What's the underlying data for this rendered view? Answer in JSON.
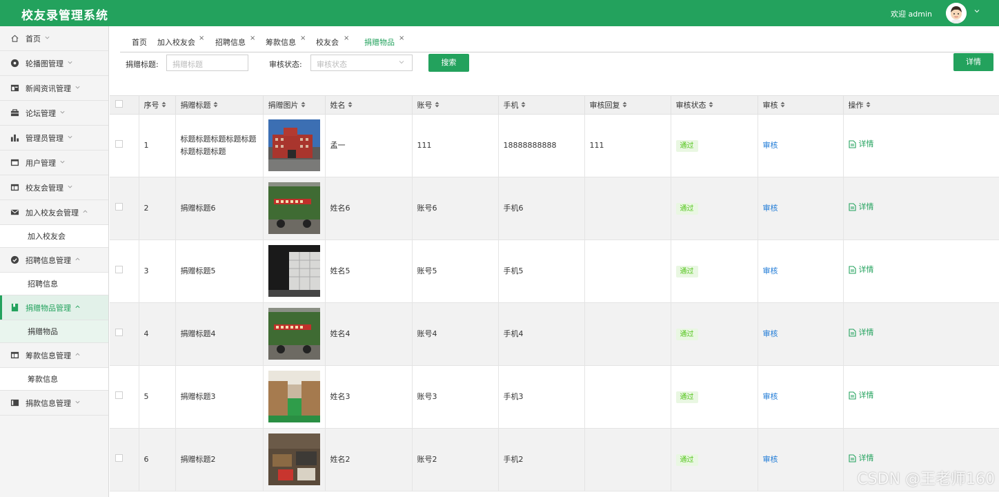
{
  "header": {
    "app_title": "校友录管理系统",
    "welcome": "欢迎 admin"
  },
  "sidebar": {
    "items": [
      {
        "label": "首页",
        "icon": "home-icon",
        "expanded": false,
        "active": false
      },
      {
        "label": "轮播图管理",
        "icon": "carousel-icon",
        "expanded": false,
        "active": false
      },
      {
        "label": "新闻资讯管理",
        "icon": "news-icon",
        "expanded": false,
        "active": false
      },
      {
        "label": "论坛管理",
        "icon": "forum-icon",
        "expanded": false,
        "active": false
      },
      {
        "label": "管理员管理",
        "icon": "admin-chart-icon",
        "expanded": false,
        "active": false
      },
      {
        "label": "用户管理",
        "icon": "user-card-icon",
        "expanded": false,
        "active": false
      },
      {
        "label": "校友会管理",
        "icon": "table-icon",
        "expanded": false,
        "active": false
      },
      {
        "label": "加入校友会管理",
        "icon": "envelope-icon",
        "expanded": true,
        "active": false,
        "sub": "加入校友会"
      },
      {
        "label": "招聘信息管理",
        "icon": "check-circle-icon",
        "expanded": true,
        "active": false,
        "sub": "招聘信息"
      },
      {
        "label": "捐赠物品管理",
        "icon": "bookmark-icon",
        "expanded": true,
        "active": true,
        "sub": "捐赠物品"
      },
      {
        "label": "筹款信息管理",
        "icon": "table-icon",
        "expanded": true,
        "active": false,
        "sub": "筹款信息"
      },
      {
        "label": "捐款信息管理",
        "icon": "list-card-icon",
        "expanded": false,
        "active": false
      }
    ]
  },
  "tabs": [
    {
      "label": "首页",
      "closable": false,
      "active": false
    },
    {
      "label": "加入校友会",
      "closable": true,
      "active": false
    },
    {
      "label": "招聘信息",
      "closable": true,
      "active": false
    },
    {
      "label": "筹款信息",
      "closable": true,
      "active": false
    },
    {
      "label": "校友会",
      "closable": true,
      "active": false
    },
    {
      "label": "捐赠物品",
      "closable": true,
      "active": true
    }
  ],
  "tab_close_glyph": "×",
  "search": {
    "title_label": "捐赠标题:",
    "title_placeholder": "捐赠标题",
    "status_label": "审核状态:",
    "status_placeholder": "审核状态",
    "search_button": "搜索",
    "detail_button": "详情"
  },
  "table": {
    "columns": [
      "序号",
      "捐赠标题",
      "捐赠图片",
      "姓名",
      "账号",
      "手机",
      "审核回复",
      "审核状态",
      "审核",
      "操作"
    ],
    "rows": [
      {
        "no": "1",
        "title": "标题标题标题标题标题标题标题标题",
        "image": "red-brick-building",
        "name": "孟一",
        "account": "111",
        "phone": "18888888888",
        "reply": "111",
        "status": "通过",
        "review": "审核",
        "action": "详情"
      },
      {
        "no": "2",
        "title": "捐赠标题6",
        "image": "green-truck-banner",
        "name": "姓名6",
        "account": "账号6",
        "phone": "手机6",
        "reply": "",
        "status": "通过",
        "review": "审核",
        "action": "详情"
      },
      {
        "no": "3",
        "title": "捐赠标题5",
        "image": "warehouse-bags",
        "name": "姓名5",
        "account": "账号5",
        "phone": "手机5",
        "reply": "",
        "status": "通过",
        "review": "审核",
        "action": "详情"
      },
      {
        "no": "4",
        "title": "捐赠标题4",
        "image": "green-truck-banner",
        "name": "姓名4",
        "account": "账号4",
        "phone": "手机4",
        "reply": "",
        "status": "通过",
        "review": "审核",
        "action": "详情"
      },
      {
        "no": "5",
        "title": "捐赠标题3",
        "image": "warehouse-boxes",
        "name": "姓名3",
        "account": "账号3",
        "phone": "手机3",
        "reply": "",
        "status": "通过",
        "review": "审核",
        "action": "详情"
      },
      {
        "no": "6",
        "title": "捐赠标题2",
        "image": "supplies-pile",
        "name": "姓名2",
        "account": "账号2",
        "phone": "手机2",
        "reply": "",
        "status": "通过",
        "review": "审核",
        "action": "详情"
      }
    ]
  },
  "colors": {
    "accent": "#23a25d",
    "link_blue": "#1e7ad6",
    "badge_green": "#52c41a"
  },
  "watermark": "CSDN @王老师160"
}
